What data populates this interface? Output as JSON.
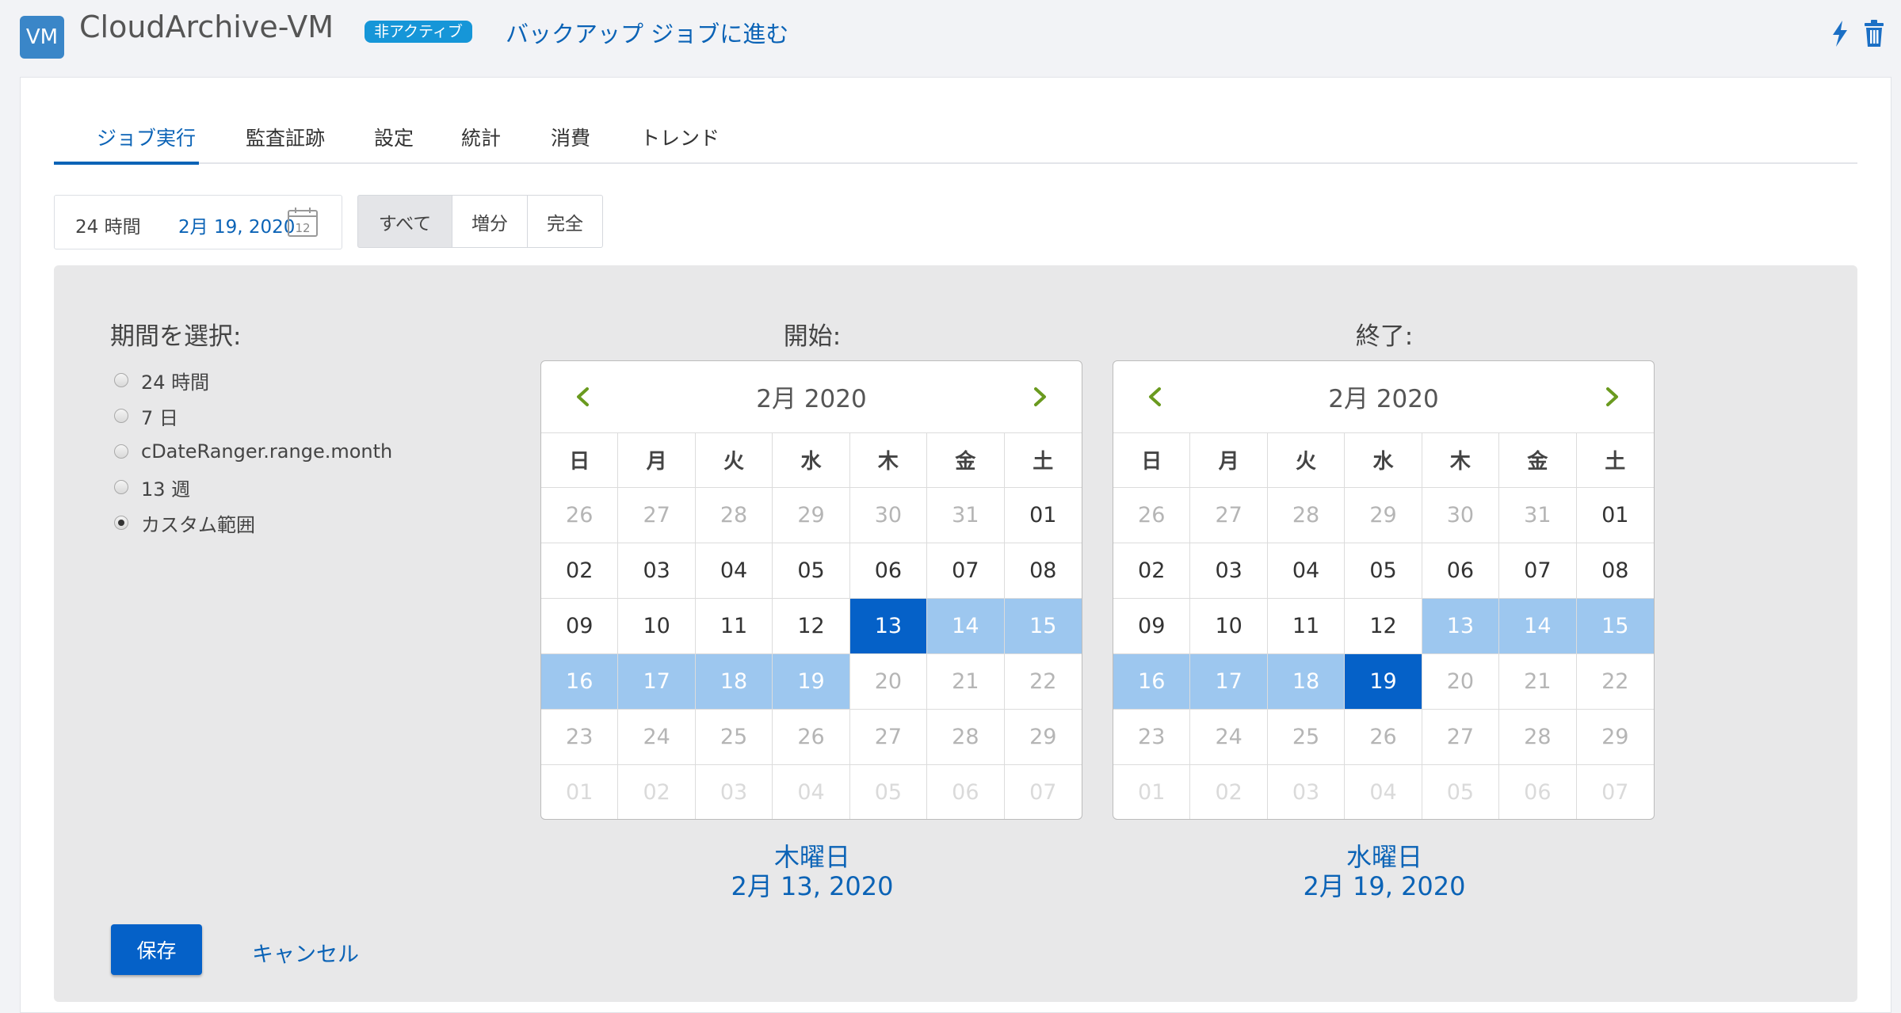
{
  "header": {
    "vm_badge": "VM",
    "title": "CloudArchive-VM",
    "status_badge": "非アクティブ",
    "goto_link": "バックアップ ジョブに進む",
    "icons": [
      "lightning-icon",
      "trash-icon"
    ],
    "accent_color": "#0b63b6"
  },
  "tabs": [
    {
      "label": "ジョブ実行",
      "active": true
    },
    {
      "label": "監査証跡",
      "active": false
    },
    {
      "label": "設定",
      "active": false
    },
    {
      "label": "統計",
      "active": false
    },
    {
      "label": "消費",
      "active": false
    },
    {
      "label": "トレンド",
      "active": false
    }
  ],
  "range_selector": {
    "label": "24 時間",
    "date": "2月 19, 2020",
    "calendar_icon_text": "12"
  },
  "filter": {
    "options": [
      "すべて",
      "増分",
      "完全"
    ],
    "selected": "すべて"
  },
  "panel": {
    "period_title": "期間を選択:",
    "options": [
      {
        "label": "24 時間",
        "checked": false
      },
      {
        "label": "7 日",
        "checked": false
      },
      {
        "label": "cDateRanger.range.month",
        "checked": false
      },
      {
        "label": "13 週",
        "checked": false
      },
      {
        "label": "カスタム範囲",
        "checked": true
      }
    ],
    "weekdays": [
      "日",
      "月",
      "火",
      "水",
      "木",
      "金",
      "土"
    ],
    "start": {
      "title": "開始:",
      "month_label": "2月 2020",
      "selected_dow": "木曜日",
      "selected_date": "2月 13, 2020"
    },
    "end": {
      "title": "終了:",
      "month_label": "2月 2020",
      "selected_dow": "水曜日",
      "selected_date": "2月 19, 2020"
    },
    "save_label": "保存",
    "cancel_label": "キャンセル"
  }
}
